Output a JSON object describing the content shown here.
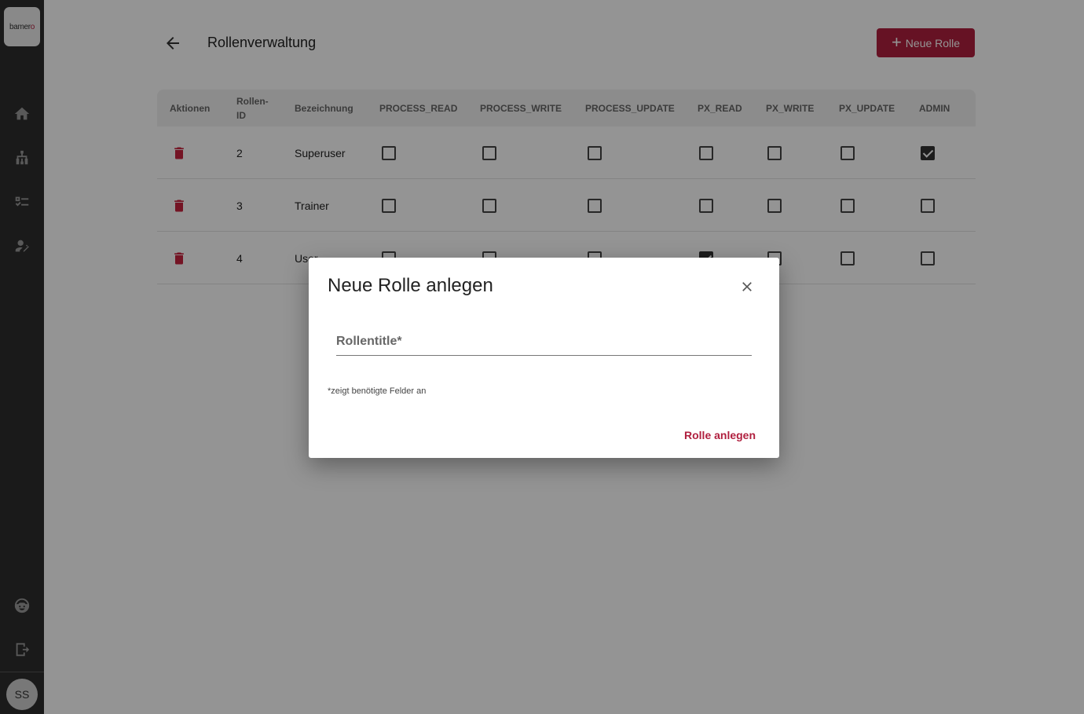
{
  "sidebar": {
    "logo_text": "bamer",
    "logo_accent": "o",
    "avatar_initials": "SS"
  },
  "header": {
    "title": "Rollenverwaltung",
    "new_role_label": "Neue Rolle"
  },
  "table": {
    "headers": [
      "Aktionen",
      "Rollen-\nID",
      "Bezeichnung",
      "PROCESS_READ",
      "PROCESS_WRITE",
      "PROCESS_UPDATE",
      "PX_READ",
      "PX_WRITE",
      "PX_UPDATE",
      "ADMIN"
    ],
    "rows": [
      {
        "id": "2",
        "name": "Superuser",
        "perms": [
          false,
          false,
          false,
          false,
          false,
          false,
          true
        ]
      },
      {
        "id": "3",
        "name": "Trainer",
        "perms": [
          false,
          false,
          false,
          false,
          false,
          false,
          false
        ]
      },
      {
        "id": "4",
        "name": "User",
        "perms": [
          false,
          false,
          false,
          true,
          false,
          false,
          false
        ]
      }
    ]
  },
  "dialog": {
    "title": "Neue Rolle anlegen",
    "field_label": "Rollentitle*",
    "field_value": "",
    "hint": "*zeigt benötigte Felder an",
    "submit_label": "Rolle anlegen"
  },
  "colors": {
    "accent": "#b0203f",
    "sidebar": "#2e2e2e",
    "trash": "#c8243e"
  }
}
